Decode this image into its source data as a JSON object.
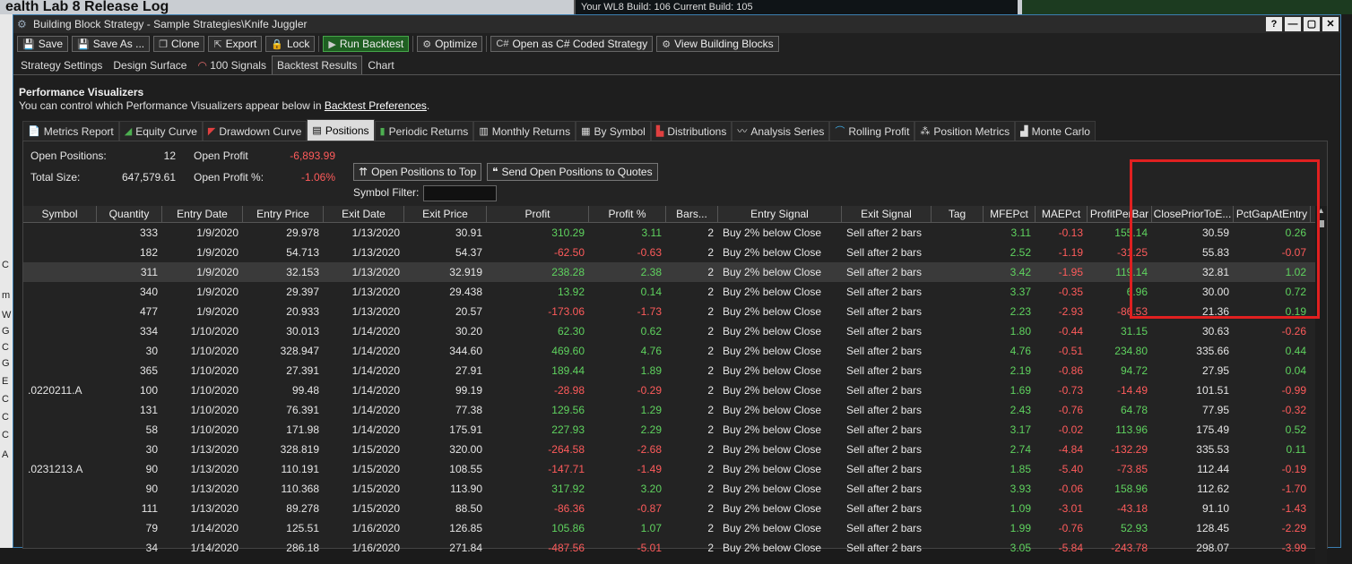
{
  "background": {
    "left_title": "ealth Lab 8 Release Log",
    "right_text": "Your WL8 Build: 106    Current Build: 105",
    "left_links": [
      "C",
      "m",
      "W",
      "G",
      "C",
      "G",
      "E",
      "C",
      "C",
      "C",
      "A"
    ]
  },
  "window": {
    "title": "Building Block Strategy - Sample Strategies\\Knife Juggler",
    "buttons": [
      "?",
      "—",
      "▢",
      "✕"
    ]
  },
  "toolbar": {
    "save": "Save",
    "save_as": "Save As ...",
    "clone": "Clone",
    "export": "Export",
    "lock": "Lock",
    "run_backtest": "Run Backtest",
    "optimize": "Optimize",
    "open_csharp": "Open as C# Coded Strategy",
    "view_blocks": "View Building Blocks"
  },
  "main_tabs": [
    "Strategy Settings",
    "Design Surface",
    "100 Signals",
    "Backtest Results",
    "Chart"
  ],
  "perf": {
    "heading": "Performance Visualizers",
    "sub_before": "You can control which Performance Visualizers appear below in ",
    "sub_link": "Backtest Preferences",
    "sub_after": "."
  },
  "viz_tabs": [
    "Metrics Report",
    "Equity Curve",
    "Drawdown Curve",
    "Positions",
    "Periodic Returns",
    "Monthly Returns",
    "By Symbol",
    "Distributions",
    "Analysis Series",
    "Rolling Profit",
    "Position Metrics",
    "Monte Carlo"
  ],
  "summary": {
    "open_positions_label": "Open Positions:",
    "open_positions": "12",
    "total_size_label": "Total Size:",
    "total_size": "647,579.61",
    "open_profit_label": "Open Profit",
    "open_profit": "-6,893.99",
    "open_profit_pct_label": "Open Profit %:",
    "open_profit_pct": "-1.06%",
    "symbol_filter_label": "Symbol Filter:",
    "btn_open_to_top": "Open Positions to Top",
    "btn_send_quotes": "Send Open Positions to Quotes"
  },
  "columns": [
    "Symbol",
    "Quantity",
    "Entry Date",
    "Entry Price",
    "Exit Date",
    "Exit Price",
    "Profit",
    "Profit %",
    "Bars...",
    "Entry Signal",
    "Exit Signal",
    "Tag",
    "MFEPct",
    "MAEPct",
    "ProfitPerBar",
    "ClosePriorToE...",
    "PctGapAtEntry"
  ],
  "rows": [
    [
      "",
      "333",
      "1/9/2020",
      "29.978",
      "1/13/2020",
      "30.91",
      "310.29",
      "3.11",
      "2",
      "Buy 2%  below Close",
      "Sell after 2 bars",
      "",
      "3.11",
      "-0.13",
      "155.14",
      "30.59",
      "0.26"
    ],
    [
      "",
      "182",
      "1/9/2020",
      "54.713",
      "1/13/2020",
      "54.37",
      "-62.50",
      "-0.63",
      "2",
      "Buy 2%  below Close",
      "Sell after 2 bars",
      "",
      "2.52",
      "-1.19",
      "-31.25",
      "55.83",
      "-0.07"
    ],
    [
      "",
      "311",
      "1/9/2020",
      "32.153",
      "1/13/2020",
      "32.919",
      "238.28",
      "2.38",
      "2",
      "Buy 2%  below Close",
      "Sell after 2 bars",
      "",
      "3.42",
      "-1.95",
      "119.14",
      "32.81",
      "1.02"
    ],
    [
      "",
      "340",
      "1/9/2020",
      "29.397",
      "1/13/2020",
      "29.438",
      "13.92",
      "0.14",
      "2",
      "Buy 2%  below Close",
      "Sell after 2 bars",
      "",
      "3.37",
      "-0.35",
      "6.96",
      "30.00",
      "0.72"
    ],
    [
      "",
      "477",
      "1/9/2020",
      "20.933",
      "1/13/2020",
      "20.57",
      "-173.06",
      "-1.73",
      "2",
      "Buy 2%  below Close",
      "Sell after 2 bars",
      "",
      "2.23",
      "-2.93",
      "-86.53",
      "21.36",
      "0.19"
    ],
    [
      "",
      "334",
      "1/10/2020",
      "30.013",
      "1/14/2020",
      "30.20",
      "62.30",
      "0.62",
      "2",
      "Buy 2%  below Close",
      "Sell after 2 bars",
      "",
      "1.80",
      "-0.44",
      "31.15",
      "30.63",
      "-0.26"
    ],
    [
      "",
      "30",
      "1/10/2020",
      "328.947",
      "1/14/2020",
      "344.60",
      "469.60",
      "4.76",
      "2",
      "Buy 2%  below Close",
      "Sell after 2 bars",
      "",
      "4.76",
      "-0.51",
      "234.80",
      "335.66",
      "0.44"
    ],
    [
      "",
      "365",
      "1/10/2020",
      "27.391",
      "1/14/2020",
      "27.91",
      "189.44",
      "1.89",
      "2",
      "Buy 2%  below Close",
      "Sell after 2 bars",
      "",
      "2.19",
      "-0.86",
      "94.72",
      "27.95",
      "0.04"
    ],
    [
      ".0220211.A",
      "100",
      "1/10/2020",
      "99.48",
      "1/14/2020",
      "99.19",
      "-28.98",
      "-0.29",
      "2",
      "Buy 2%  below Close",
      "Sell after 2 bars",
      "",
      "1.69",
      "-0.73",
      "-14.49",
      "101.51",
      "-0.99"
    ],
    [
      "",
      "131",
      "1/10/2020",
      "76.391",
      "1/14/2020",
      "77.38",
      "129.56",
      "1.29",
      "2",
      "Buy 2%  below Close",
      "Sell after 2 bars",
      "",
      "2.43",
      "-0.76",
      "64.78",
      "77.95",
      "-0.32"
    ],
    [
      "",
      "58",
      "1/10/2020",
      "171.98",
      "1/14/2020",
      "175.91",
      "227.93",
      "2.29",
      "2",
      "Buy 2%  below Close",
      "Sell after 2 bars",
      "",
      "3.17",
      "-0.02",
      "113.96",
      "175.49",
      "0.52"
    ],
    [
      "",
      "30",
      "1/13/2020",
      "328.819",
      "1/15/2020",
      "320.00",
      "-264.58",
      "-2.68",
      "2",
      "Buy 2%  below Close",
      "Sell after 2 bars",
      "",
      "2.74",
      "-4.84",
      "-132.29",
      "335.53",
      "0.11"
    ],
    [
      ".0231213.A",
      "90",
      "1/13/2020",
      "110.191",
      "1/15/2020",
      "108.55",
      "-147.71",
      "-1.49",
      "2",
      "Buy 2%  below Close",
      "Sell after 2 bars",
      "",
      "1.85",
      "-5.40",
      "-73.85",
      "112.44",
      "-0.19"
    ],
    [
      "",
      "90",
      "1/13/2020",
      "110.368",
      "1/15/2020",
      "113.90",
      "317.92",
      "3.20",
      "2",
      "Buy 2%  below Close",
      "Sell after 2 bars",
      "",
      "3.93",
      "-0.06",
      "158.96",
      "112.62",
      "-1.70"
    ],
    [
      "",
      "111",
      "1/13/2020",
      "89.278",
      "1/15/2020",
      "88.50",
      "-86.36",
      "-0.87",
      "2",
      "Buy 2%  below Close",
      "Sell after 2 bars",
      "",
      "1.09",
      "-3.01",
      "-43.18",
      "91.10",
      "-1.43"
    ],
    [
      "",
      "79",
      "1/14/2020",
      "125.51",
      "1/16/2020",
      "126.85",
      "105.86",
      "1.07",
      "2",
      "Buy 2%  below Close",
      "Sell after 2 bars",
      "",
      "1.99",
      "-0.76",
      "52.93",
      "128.45",
      "-2.29"
    ],
    [
      "",
      "34",
      "1/14/2020",
      "286.18",
      "1/16/2020",
      "271.84",
      "-487.56",
      "-5.01",
      "2",
      "Buy 2%  below Close",
      "Sell after 2 bars",
      "",
      "3.05",
      "-5.84",
      "-243.78",
      "298.07",
      "-3.99"
    ]
  ],
  "colors": {
    "positive": "#5fd35f",
    "negative": "#ff5b5b",
    "highlight": "#e02020"
  }
}
